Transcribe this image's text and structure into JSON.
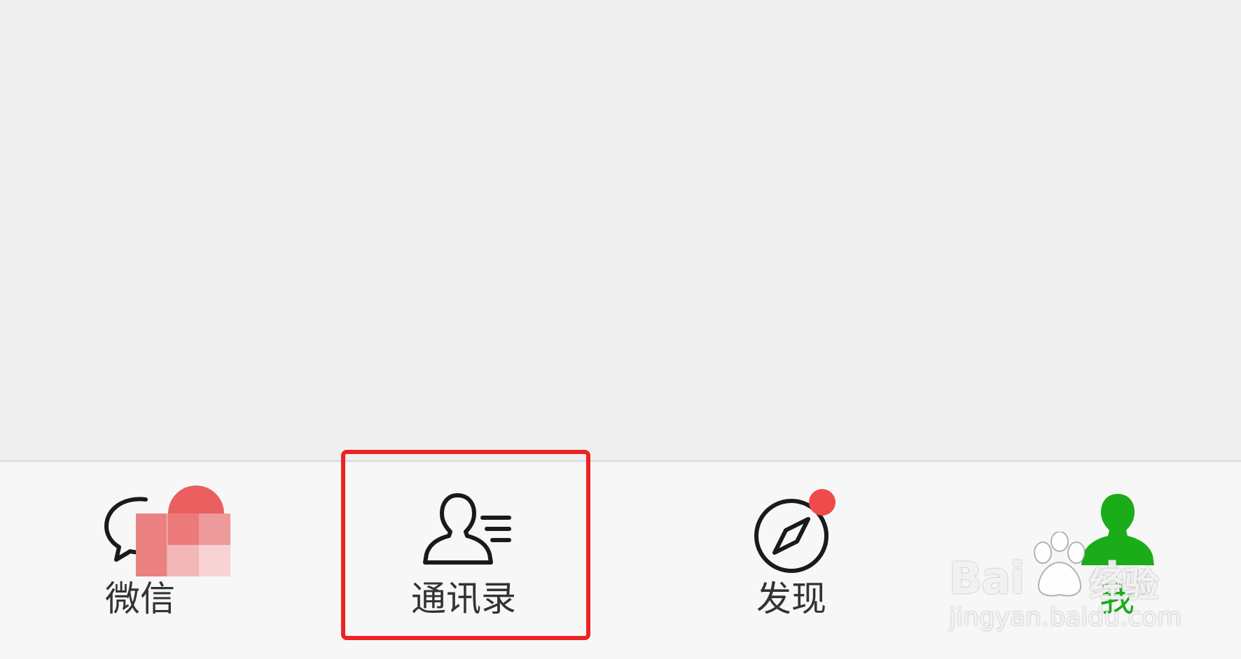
{
  "tabbar": {
    "tabs": [
      {
        "id": "chats",
        "label": "微信",
        "icon": "chat-bubbles-icon",
        "active": false
      },
      {
        "id": "contacts",
        "label": "通讯录",
        "icon": "contacts-icon",
        "active": false
      },
      {
        "id": "discover",
        "label": "发现",
        "icon": "compass-icon",
        "active": false,
        "badge_dot": true
      },
      {
        "id": "me",
        "label": "我",
        "icon": "person-icon",
        "active": true
      }
    ]
  },
  "watermark": {
    "logo_text": "Bai",
    "logo_suffix": "du",
    "cn_text": "经验",
    "url": "jingyan.baidu.com"
  },
  "colors": {
    "content_background": "#efefef",
    "tabbar_background": "#f7f7f7",
    "icon_default": "#1a1a1a",
    "active_green": "#1aad19",
    "badge_red": "#f04a4a",
    "highlight_red": "#ee2222"
  }
}
